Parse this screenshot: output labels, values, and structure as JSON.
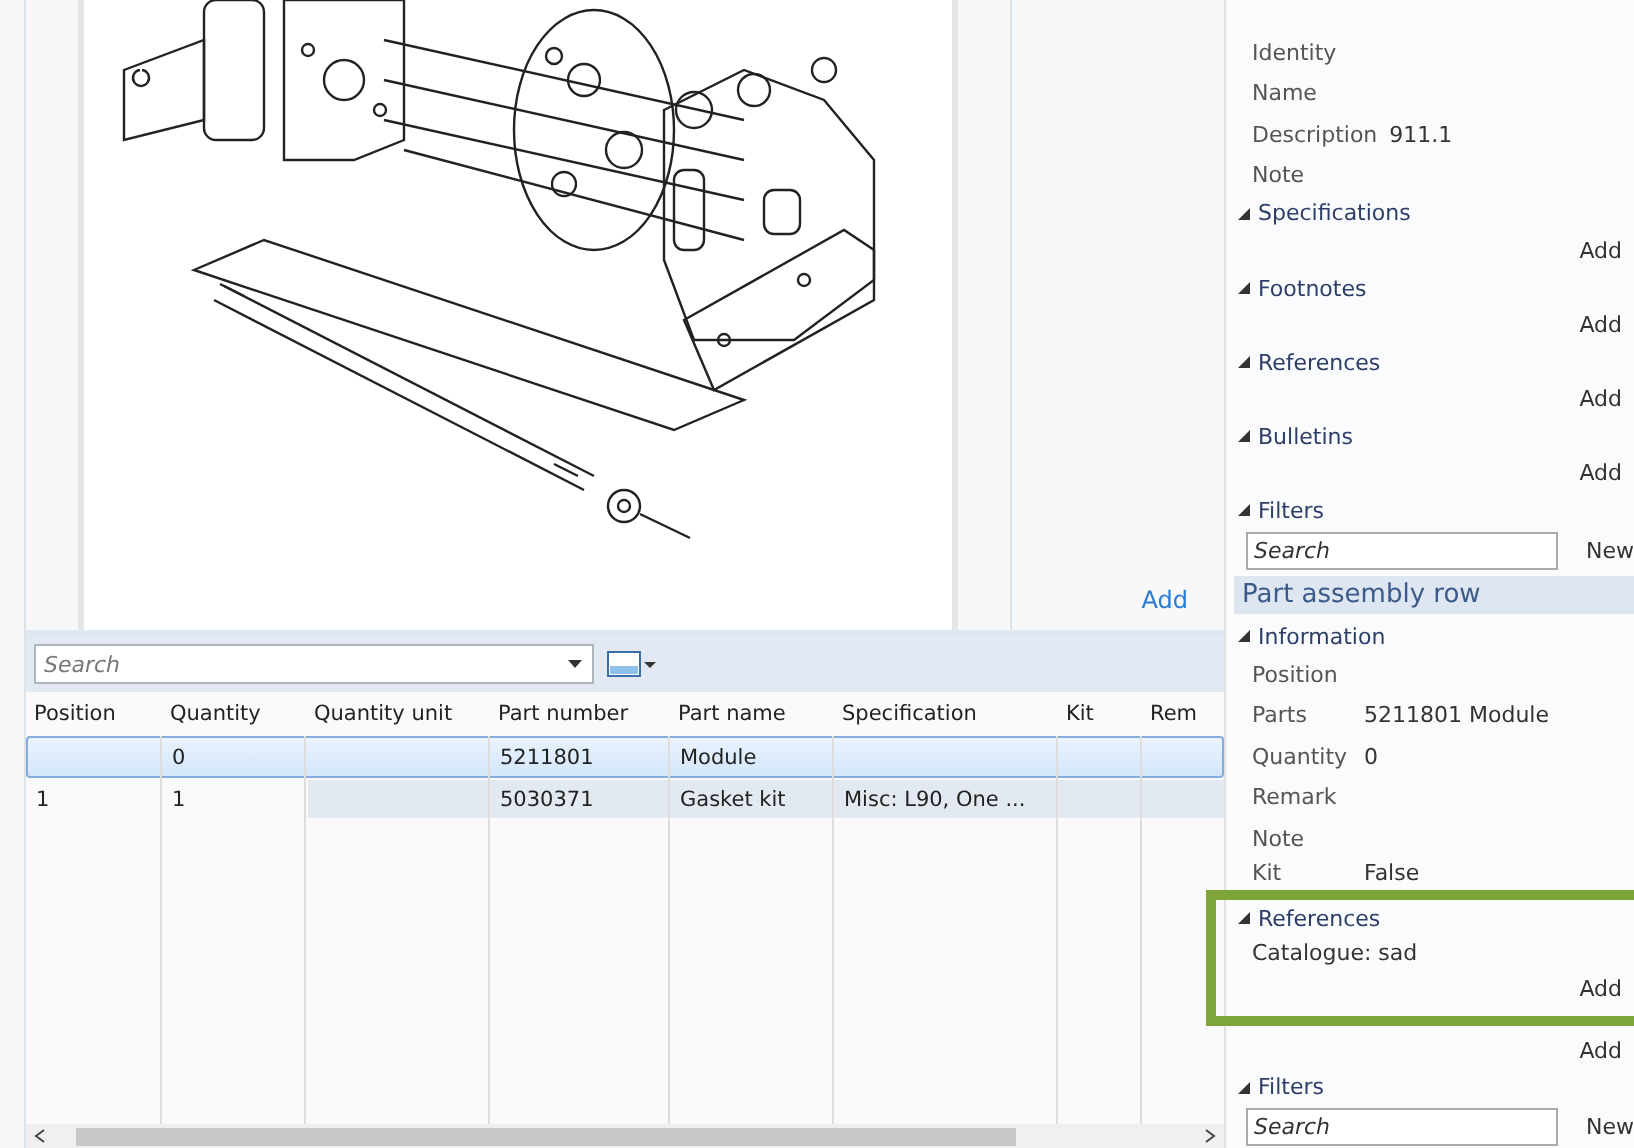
{
  "diagram_panel": {
    "add_link": "Add"
  },
  "toolbar": {
    "search": {
      "placeholder": "Search"
    }
  },
  "table": {
    "columns": [
      "Position",
      "Quantity",
      "Quantity unit",
      "Part number",
      "Part name",
      "Specification",
      "Kit",
      "Rem"
    ],
    "rows": [
      {
        "selected": true,
        "cells": [
          "",
          "0",
          "",
          "5211801",
          "Module",
          "",
          "",
          ""
        ]
      },
      {
        "selected": false,
        "cells": [
          "1",
          "1",
          "",
          "5030371",
          "Gasket kit",
          "Misc: L90, One ...",
          "",
          ""
        ]
      }
    ]
  },
  "properties": [
    {
      "kind": "field",
      "label": "Identity"
    },
    {
      "kind": "field",
      "label": "Name"
    },
    {
      "kind": "field",
      "label": "Description",
      "value": "911.1"
    },
    {
      "kind": "field",
      "label": "Note"
    },
    {
      "kind": "section",
      "title": "Specifications",
      "expanded": true
    },
    {
      "kind": "add",
      "label": "Add"
    },
    {
      "kind": "section",
      "title": "Footnotes",
      "expanded": true
    },
    {
      "kind": "add",
      "label": "Add"
    },
    {
      "kind": "section",
      "title": "References",
      "expanded": true
    },
    {
      "kind": "add",
      "label": "Add"
    },
    {
      "kind": "section",
      "title": "Bulletins",
      "expanded": true
    },
    {
      "kind": "add",
      "label": "Add"
    },
    {
      "kind": "section",
      "title": "Filters",
      "expanded": true
    },
    {
      "kind": "search",
      "placeholder": "Search",
      "button": "New"
    },
    {
      "kind": "header",
      "title": "Part assembly row"
    },
    {
      "kind": "section",
      "title": "Information",
      "expanded": true
    },
    {
      "kind": "field",
      "label": "Position"
    },
    {
      "kind": "field",
      "label": "Parts",
      "value": "5211801 Module"
    },
    {
      "kind": "field",
      "label": "Quantity",
      "value": "0"
    },
    {
      "kind": "field",
      "label": "Remark"
    },
    {
      "kind": "field",
      "label": "Note"
    },
    {
      "kind": "compact",
      "label": "Kit",
      "value": "False"
    },
    {
      "kind": "highlight",
      "items": [
        {
          "kind": "section",
          "title": "References",
          "expanded": true
        },
        {
          "kind": "text",
          "text": "Catalogue: sad"
        },
        {
          "kind": "add",
          "label": "Add"
        }
      ]
    },
    {
      "kind": "add",
      "label": "Add"
    },
    {
      "kind": "section",
      "title": "Filters",
      "expanded": true
    },
    {
      "kind": "search",
      "placeholder": "Search",
      "button": "New"
    }
  ]
}
